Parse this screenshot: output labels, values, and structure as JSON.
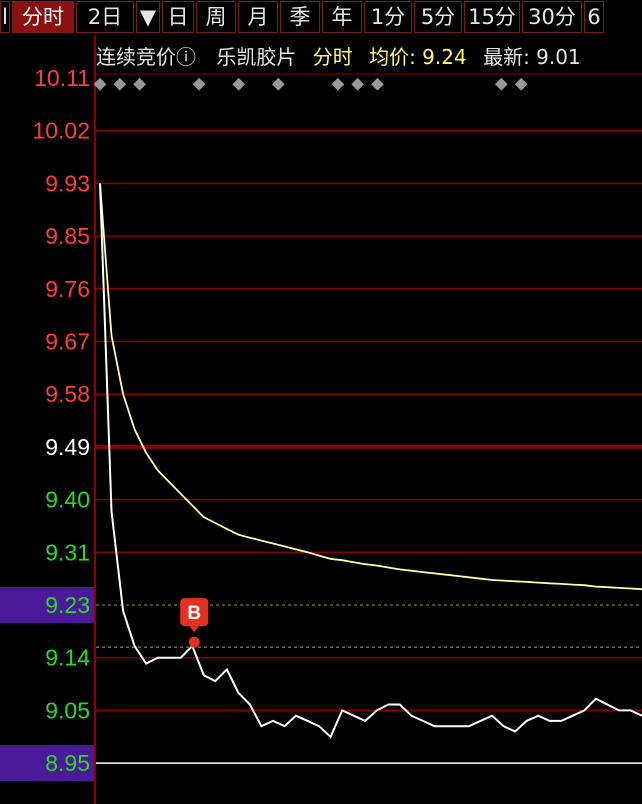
{
  "tabs": [
    {
      "label": "l",
      "active": false
    },
    {
      "label": "分时",
      "active": true
    },
    {
      "label": "2日",
      "active": false
    },
    {
      "label": "▼",
      "active": false
    },
    {
      "label": "日",
      "active": false
    },
    {
      "label": "周",
      "active": false
    },
    {
      "label": "月",
      "active": false
    },
    {
      "label": "季",
      "active": false
    },
    {
      "label": "年",
      "active": false
    },
    {
      "label": "1分",
      "active": false
    },
    {
      "label": "5分",
      "active": false
    },
    {
      "label": "15分",
      "active": false
    },
    {
      "label": "30分",
      "active": false
    },
    {
      "label": "6",
      "active": false
    }
  ],
  "info": {
    "auction": "连续竞价",
    "info_icon": "ⓘ",
    "stock_name": "乐凯胶片",
    "mode": "分时",
    "avg_label": "均价: 9.24",
    "latest_label": "最新: 9.01"
  },
  "colors": {
    "up": "#ff3b3b",
    "down": "#22dd22",
    "neutral": "#ffffff",
    "avg_line": "#ffffa0",
    "price_line": "#ffffff",
    "grid": "#8b0000",
    "highlight": "#4b1a99"
  },
  "chart_data": {
    "type": "line",
    "prev_close": 9.49,
    "y_ticks": [
      "10.11",
      "10.02",
      "9.93",
      "9.85",
      "9.76",
      "9.67",
      "9.58",
      "9.49",
      "9.40",
      "9.31",
      "9.23",
      "9.14",
      "9.05",
      "8.95"
    ],
    "highlighted_ticks": [
      "9.23",
      "8.95"
    ],
    "price_series": [
      9.93,
      9.38,
      9.22,
      9.16,
      9.13,
      9.14,
      9.14,
      9.14,
      9.16,
      9.11,
      9.1,
      9.12,
      9.08,
      9.06,
      9.02,
      9.03,
      9.02,
      9.04,
      9.03,
      9.02,
      9.0,
      9.05,
      9.04,
      9.03,
      9.05,
      9.06,
      9.06,
      9.04,
      9.03,
      9.02,
      9.02,
      9.02,
      9.02,
      9.03,
      9.04,
      9.02,
      9.01,
      9.03,
      9.04,
      9.03,
      9.03,
      9.04,
      9.05,
      9.07,
      9.06,
      9.05,
      9.05,
      9.04
    ],
    "avg_series": [
      9.93,
      9.68,
      9.58,
      9.52,
      9.48,
      9.45,
      9.43,
      9.41,
      9.39,
      9.37,
      9.36,
      9.35,
      9.34,
      9.335,
      9.33,
      9.325,
      9.32,
      9.315,
      9.31,
      9.305,
      9.3,
      9.298,
      9.295,
      9.292,
      9.29,
      9.287,
      9.284,
      9.282,
      9.28,
      9.278,
      9.276,
      9.274,
      9.272,
      9.27,
      9.268,
      9.267,
      9.266,
      9.265,
      9.264,
      9.263,
      9.262,
      9.261,
      9.26,
      9.258,
      9.257,
      9.256,
      9.255,
      9.254
    ],
    "buy_marker": {
      "label": "B",
      "price": 9.17,
      "index": 8
    },
    "marker_line_price": 9.17,
    "event_marker_positions": [
      0,
      1,
      2,
      5,
      7,
      9,
      12,
      13,
      14,
      20,
      21,
      28,
      29
    ]
  }
}
